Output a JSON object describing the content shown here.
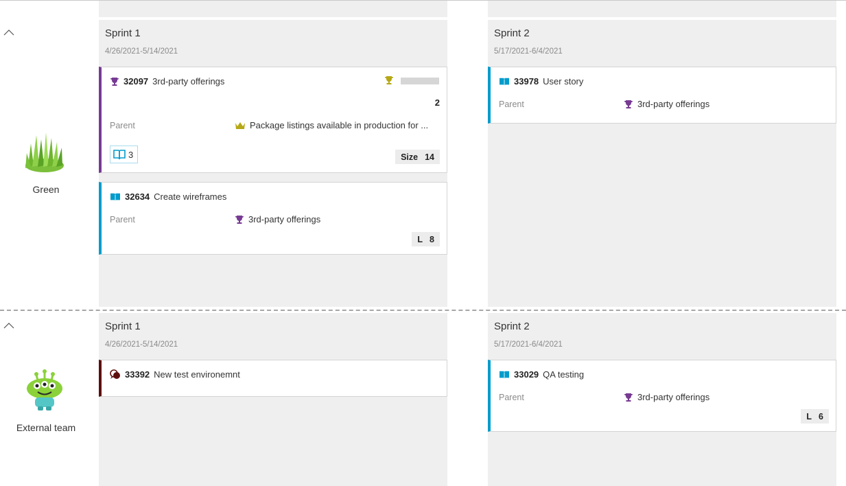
{
  "colors": {
    "story_accent": "#009ccc",
    "feature_accent": "#773b93",
    "issue_accent": "#5d0f0f",
    "column_bg": "#efefef"
  },
  "lanes": [
    {
      "team": "Green",
      "avatar_icon": "grass-icon",
      "columns": [
        {
          "title": "Sprint 1",
          "dates": "4/26/2021-5/14/2021",
          "cards": [
            {
              "type": "feature",
              "type_icon": "trophy-icon",
              "id": "32097",
              "title": "3rd-party offerings",
              "progress_value": "2",
              "parent_label": "Parent",
              "parent_icon": "crown-icon",
              "parent_value": "Package listings available in production for ...",
              "child_count": "3",
              "size_label": "Size",
              "size_value": "14"
            },
            {
              "type": "story",
              "type_icon": "book-icon",
              "id": "32634",
              "title": "Create wireframes",
              "parent_label": "Parent",
              "parent_icon": "trophy-icon",
              "parent_value": "3rd-party offerings",
              "size_label": "L",
              "size_value": "8"
            }
          ]
        },
        {
          "title": "Sprint 2",
          "dates": "5/17/2021-6/4/2021",
          "cards": [
            {
              "type": "story",
              "type_icon": "book-icon",
              "id": "33978",
              "title": "User story",
              "parent_label": "Parent",
              "parent_icon": "trophy-icon",
              "parent_value": "3rd-party offerings"
            }
          ]
        }
      ]
    },
    {
      "team": "External team",
      "avatar_icon": "alien-icon",
      "columns": [
        {
          "title": "Sprint 1",
          "dates": "4/26/2021-5/14/2021",
          "cards": [
            {
              "type": "issue",
              "type_icon": "issue-icon",
              "id": "33392",
              "title": "New test environemnt"
            }
          ]
        },
        {
          "title": "Sprint 2",
          "dates": "5/17/2021-6/4/2021",
          "cards": [
            {
              "type": "story",
              "type_icon": "book-icon",
              "id": "33029",
              "title": "QA testing",
              "parent_label": "Parent",
              "parent_icon": "trophy-icon",
              "parent_value": "3rd-party offerings",
              "size_label": "L",
              "size_value": "6"
            }
          ]
        }
      ]
    }
  ]
}
